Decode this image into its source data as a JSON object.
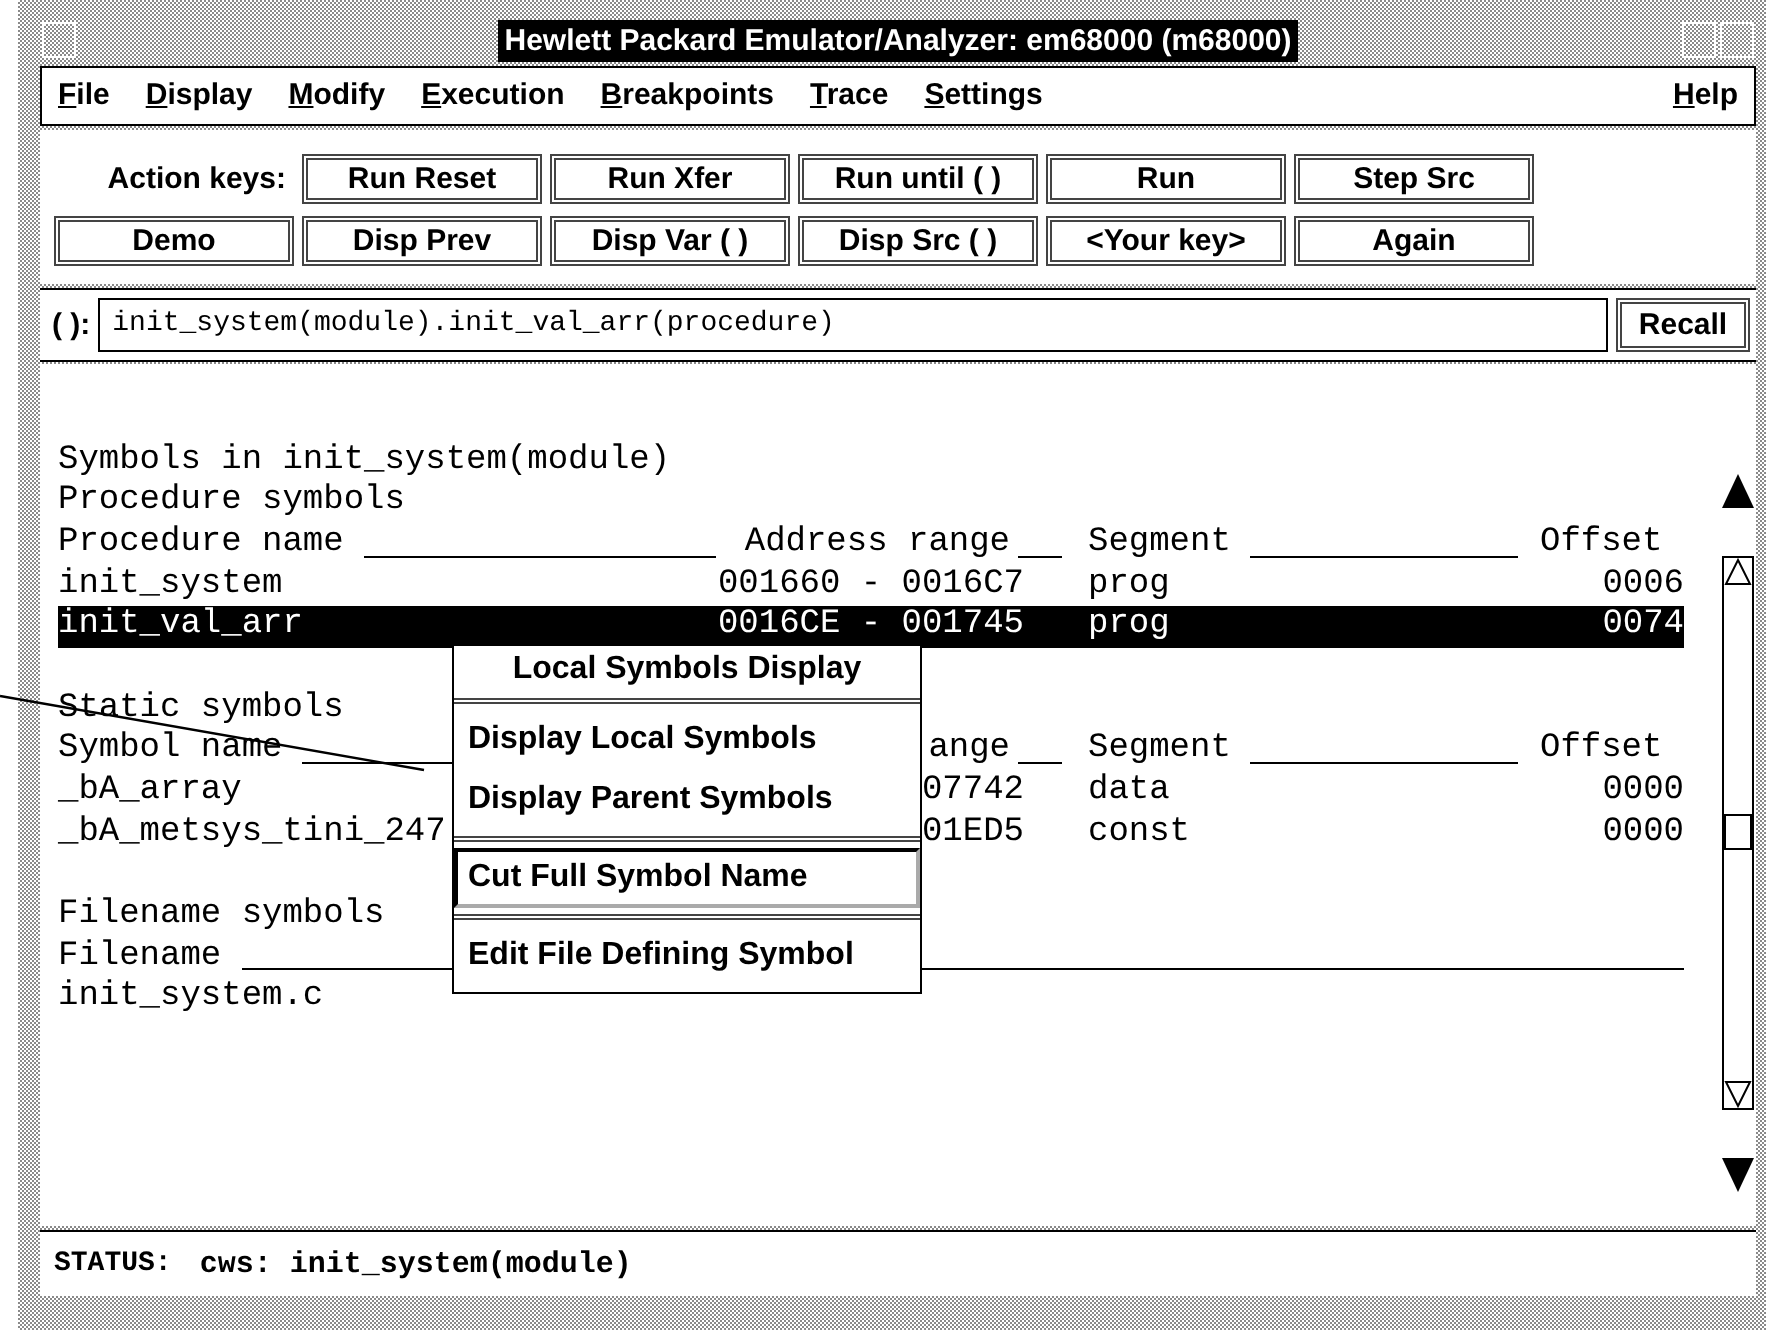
{
  "window": {
    "title": "Hewlett Packard Emulator/Analyzer: em68000 (m68000)"
  },
  "menu_bar": {
    "items": [
      "File",
      "Display",
      "Modify",
      "Execution",
      "Breakpoints",
      "Trace",
      "Settings"
    ],
    "help": "Help"
  },
  "action_keys": {
    "label": "Action keys:",
    "buttons": [
      "Run Reset",
      "Run Xfer",
      "Run until ( )",
      "Run",
      "Step Src",
      "Demo",
      "Disp Prev",
      "Disp Var ( )",
      "Disp Src ( )",
      "<Your key>",
      "Again"
    ]
  },
  "command": {
    "label": "( ):",
    "value": "init_system(module).init_val_arr(procedure)",
    "button": "Recall"
  },
  "listing": {
    "sections": [
      {
        "titles": [
          "Symbols in init_system(module)",
          "Procedure symbols"
        ],
        "header": [
          "Procedure name",
          "Address range",
          "Segment",
          "Offset"
        ],
        "rows": [
          {
            "cells": [
              "init_system",
              "001660 - 0016C7",
              "prog",
              "0006"
            ],
            "selected": false
          },
          {
            "cells": [
              "init_val_arr",
              "0016CE - 001745",
              "prog",
              "0074"
            ],
            "selected": true
          }
        ]
      },
      {
        "titles": [
          "Static symbols"
        ],
        "header": [
          "Symbol name",
          "ange",
          "Segment",
          "Offset"
        ],
        "rows": [
          {
            "cells": [
              "_bA_array",
              "07742",
              "data",
              "0000"
            ],
            "selected": false
          },
          {
            "cells": [
              "_bA_metsys_tini_247",
              "01ED5",
              "const",
              "0000"
            ],
            "selected": false
          }
        ]
      },
      {
        "titles": [
          "Filename symbols"
        ],
        "header": [
          "Filename"
        ],
        "rows": [
          {
            "cells": [
              "init_system.c"
            ],
            "selected": false
          }
        ]
      }
    ]
  },
  "popup_menu": {
    "title": "Local Symbols Display",
    "groups": [
      [
        {
          "label": "Display Local Symbols",
          "selected": false
        },
        {
          "label": "Display Parent Symbols",
          "selected": false
        }
      ],
      [
        {
          "label": "Cut Full Symbol Name",
          "selected": true
        }
      ],
      [
        {
          "label": "Edit File Defining Symbol",
          "selected": false
        }
      ]
    ]
  },
  "status_bar": {
    "label": "STATUS:",
    "text": "cws: init_system(module)"
  }
}
